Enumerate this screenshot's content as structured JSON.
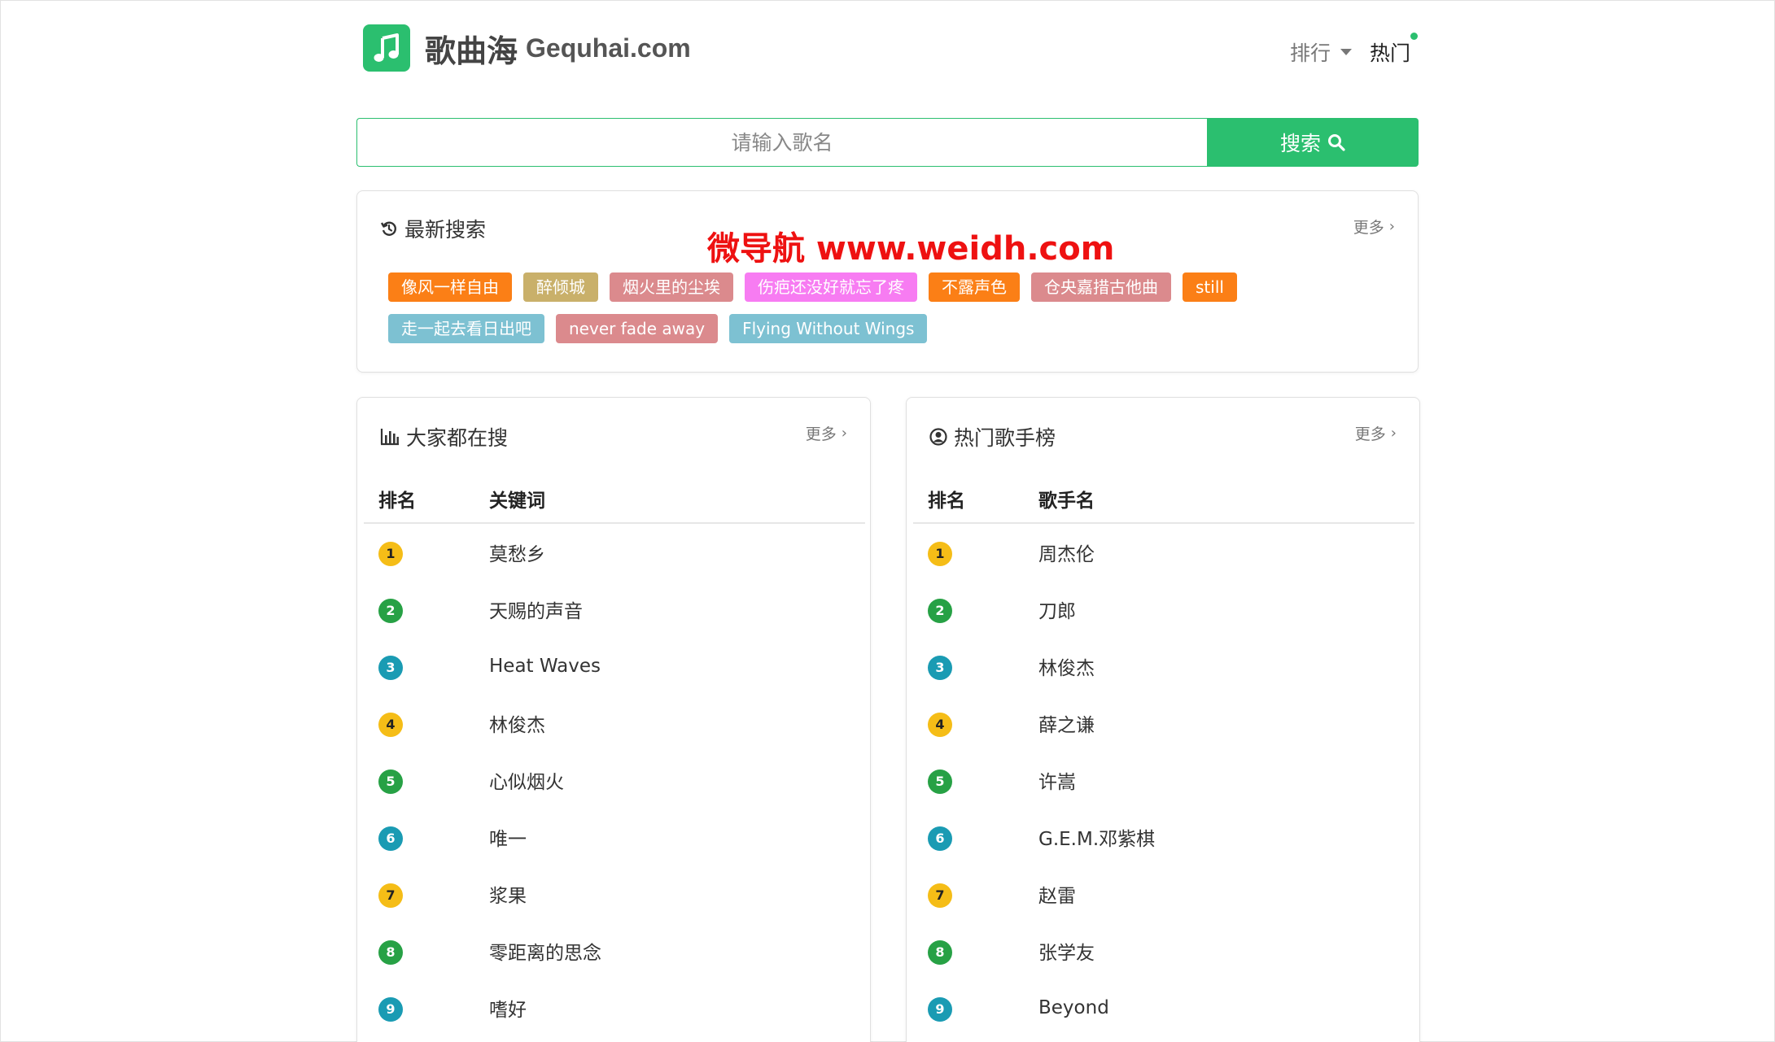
{
  "header": {
    "logo_cn": "歌曲海",
    "logo_en": "Gequhai.com",
    "nav_rank": "排行",
    "nav_hot": "热门"
  },
  "search": {
    "placeholder": "请输入歌名",
    "button_label": "搜索"
  },
  "recent": {
    "title": "最新搜索",
    "more": "更多",
    "watermark": "微导航 www.weidh.com",
    "tags": [
      {
        "label": "像风一样自由",
        "color": "#fb7f16"
      },
      {
        "label": "醉倾城",
        "color": "#c9b06a"
      },
      {
        "label": "烟火里的尘埃",
        "color": "#db8a8d"
      },
      {
        "label": "伤疤还没好就忘了疼",
        "color": "#f77cf2"
      },
      {
        "label": "不露声色",
        "color": "#fb7f16"
      },
      {
        "label": "仓央嘉措古他曲",
        "color": "#db8a8d"
      },
      {
        "label": "still",
        "color": "#fb7f16"
      },
      {
        "label": "走一起去看日出吧",
        "color": "#7dc1d2"
      },
      {
        "label": "never fade away",
        "color": "#db8a8d"
      },
      {
        "label": "Flying Without Wings",
        "color": "#7dc1d2"
      }
    ]
  },
  "popular_search": {
    "title": "大家都在搜",
    "more": "更多",
    "col_rank": "排名",
    "col_name": "关键词",
    "rows": [
      {
        "rank": "1",
        "name": "莫愁乡"
      },
      {
        "rank": "2",
        "name": "天赐的声音"
      },
      {
        "rank": "3",
        "name": "Heat Waves"
      },
      {
        "rank": "4",
        "name": "林俊杰"
      },
      {
        "rank": "5",
        "name": "心似烟火"
      },
      {
        "rank": "6",
        "name": "唯一"
      },
      {
        "rank": "7",
        "name": "浆果"
      },
      {
        "rank": "8",
        "name": "零距离的思念"
      },
      {
        "rank": "9",
        "name": "嗜好"
      }
    ]
  },
  "hot_singers": {
    "title": "热门歌手榜",
    "more": "更多",
    "col_rank": "排名",
    "col_name": "歌手名",
    "rows": [
      {
        "rank": "1",
        "name": "周杰伦"
      },
      {
        "rank": "2",
        "name": "刀郎"
      },
      {
        "rank": "3",
        "name": "林俊杰"
      },
      {
        "rank": "4",
        "name": "薛之谦"
      },
      {
        "rank": "5",
        "name": "许嵩"
      },
      {
        "rank": "6",
        "name": "G.E.M.邓紫棋"
      },
      {
        "rank": "7",
        "name": "赵雷"
      },
      {
        "rank": "8",
        "name": "张学友"
      },
      {
        "rank": "9",
        "name": "Beyond"
      }
    ]
  },
  "colors": {
    "accent": "#2bbf6f",
    "badge_yellow": "#f5bd17",
    "badge_green": "#27a145",
    "badge_teal": "#1a9bb3"
  },
  "icons": {
    "logo": "music-note-icon",
    "recent": "history-icon",
    "popular": "bar-chart-icon",
    "singers": "user-circle-icon",
    "search": "search-icon"
  }
}
